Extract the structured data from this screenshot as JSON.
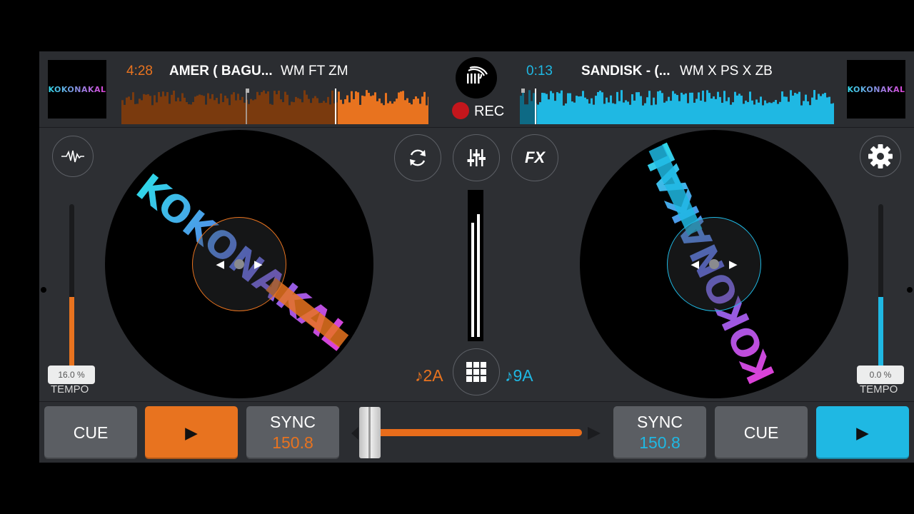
{
  "colors": {
    "deck_a": "#e8731f",
    "deck_b": "#1fb8e3",
    "background": "#2d2f33",
    "record": "#c4161c"
  },
  "deck_a": {
    "artwork_text": "KOKONAKAL",
    "time": "4:28",
    "title": "AMER ( BAGU...",
    "artist": "WM FT ZM",
    "progress": 0.7,
    "tempo_value": "16.0 %",
    "tempo_label": "TEMPO",
    "tempo_fader_level": 0.45,
    "key": "♪2A",
    "cue_label": "CUE",
    "play_icon": "▶",
    "sync_label": "SYNC",
    "bpm": "150.8",
    "side_button_icon": "waveform-icon",
    "disc_text": "KOKONAKAL"
  },
  "deck_b": {
    "artwork_text": "KOKONAKAL",
    "time": "0:13",
    "title": "SANDISK - (...",
    "artist": "WM X PS X ZB",
    "progress": 0.05,
    "tempo_value": "0.0 %",
    "tempo_label": "TEMPO",
    "tempo_fader_level": 0.45,
    "key": "♪9A",
    "cue_label": "CUE",
    "play_icon": "▶",
    "sync_label": "SYNC",
    "bpm": "150.8",
    "side_button_icon": "gear-icon",
    "disc_text": "KOKONAKAL"
  },
  "center": {
    "record_label": "REC",
    "fx_label": "FX",
    "loop_icon": "sync-icon",
    "mixer_icon": "mixer-sliders-icon",
    "sampler_icon": "grid-icon",
    "crossfader_position": 0.0
  }
}
